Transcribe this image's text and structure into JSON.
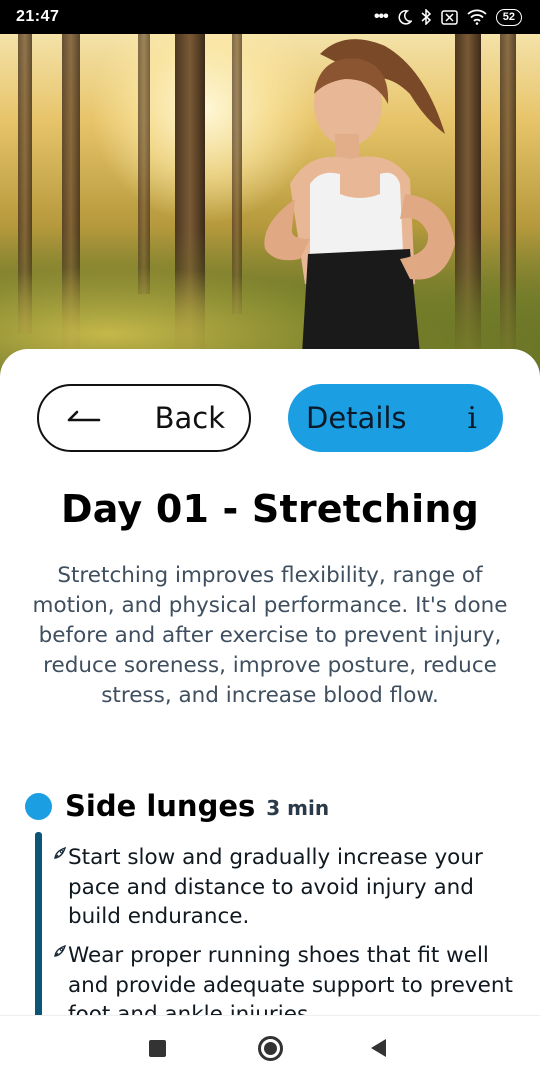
{
  "status_bar": {
    "time": "21:47",
    "icons": [
      "more-dots-icon",
      "moon-icon",
      "bluetooth-icon",
      "no-sim-icon",
      "wifi-icon",
      "battery-icon"
    ],
    "battery_level": "52"
  },
  "hero": {
    "image": "woman-jogging-in-forest-photo"
  },
  "buttons": {
    "back_label": "Back",
    "back_icon": "arrow-left-icon",
    "details_label": "Details",
    "details_icon": "info-icon",
    "details_icon_glyph": "i"
  },
  "colors": {
    "accent": "#1c9ee3",
    "timeline": "#0d5577",
    "description_text": "#3f4f5f"
  },
  "content": {
    "title": "Day 01 - Stretching",
    "description": "Stretching improves flexibility, range of motion, and physical performance. It's done before and after exercise to prevent injury, reduce soreness, improve posture, reduce stress, and increase blood flow."
  },
  "exercise": {
    "name": "Side lunges",
    "duration": "3 min",
    "tips": [
      {
        "icon": "rocket-icon",
        "text": "Start slow and gradually increase your pace and distance to avoid injury and build endurance."
      },
      {
        "icon": "rocket-icon",
        "text": "Wear proper running shoes that fit well and provide adequate support to prevent foot and ankle injuries."
      }
    ]
  },
  "nav_bar": {
    "icons": [
      "recents-square-icon",
      "home-circle-icon",
      "back-triangle-icon"
    ]
  }
}
